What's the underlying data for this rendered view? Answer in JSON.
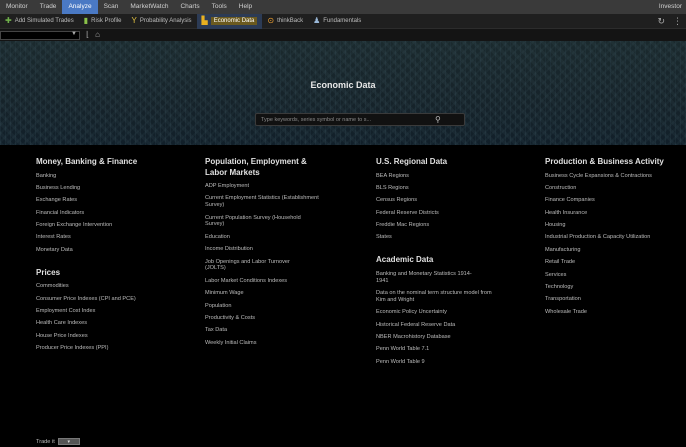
{
  "menubar": {
    "items": [
      "Monitor",
      "Trade",
      "Analyze",
      "Scan",
      "MarketWatch",
      "Charts",
      "Tools",
      "Help"
    ],
    "active_index": 2,
    "right_label": "Investor"
  },
  "toolbar": {
    "items": [
      {
        "icon": "plus-icon",
        "label": "Add Simulated Trades"
      },
      {
        "icon": "risk-profile-icon",
        "label": "Risk Profile"
      },
      {
        "icon": "probability-icon",
        "label": "Probability Analysis"
      },
      {
        "icon": "economic-data-icon",
        "label": "Economic Data"
      },
      {
        "icon": "earnings-icon",
        "label": "thinkBack"
      },
      {
        "icon": "fundamentals-icon",
        "label": "Fundamentals"
      }
    ],
    "active_index": 3
  },
  "hero": {
    "title": "Economic Data",
    "search_placeholder": "Type keywords, series symbol or name to s..."
  },
  "columns": [
    {
      "sections": [
        {
          "title": "Money, Banking & Finance",
          "items": [
            "Banking",
            "Business Lending",
            "Exchange Rates",
            "Financial Indicators",
            "Foreign Exchange Intervention",
            "Interest Rates",
            "Monetary Data"
          ]
        },
        {
          "title": "Prices",
          "items": [
            "Commodities",
            "Consumer Price Indexes (CPI and PCE)",
            "Employment Cost Index",
            "Health Care Indexes",
            "House Price Indexes",
            "Producer Price Indexes (PPI)"
          ]
        }
      ]
    },
    {
      "sections": [
        {
          "title": "Population, Employment & Labor Markets",
          "items": [
            "ADP Employment",
            "Current Employment Statistics (Establishment Survey)",
            "Current Population Survey (Household Survey)",
            "Education",
            "Income Distribution",
            "Job Openings and Labor Turnover (JOLTS)",
            "Labor Market Conditions Indexes",
            "Minimum Wage",
            "Population",
            "Productivity & Costs",
            "Tax Data",
            "Weekly Initial Claims"
          ]
        }
      ]
    },
    {
      "sections": [
        {
          "title": "U.S. Regional Data",
          "items": [
            "BEA Regions",
            "BLS Regions",
            "Census Regions",
            "Federal Reserve Districts",
            "Freddie Mac Regions",
            "States"
          ]
        },
        {
          "title": "Academic Data",
          "items": [
            "Banking and Monetary Statistics 1914-1941",
            "Data on the nominal term structure model from Kim and Wright",
            "Economic Policy Uncertainty",
            "Historical Federal Reserve Data",
            "NBER Macrohistory Database",
            "Penn World Table 7.1",
            "Penn World Table 9"
          ]
        }
      ]
    },
    {
      "sections": [
        {
          "title": "Production & Business Activity",
          "items": [
            "Business Cycle Expansions & Contractions",
            "Construction",
            "Finance Companies",
            "Health Insurance",
            "Housing",
            "Industrial Production & Capacity Utilization",
            "Manufacturing",
            "Retail Trade",
            "Services",
            "Technology",
            "Transportation",
            "Wholesale Trade"
          ]
        }
      ]
    }
  ],
  "trade_bar": {
    "label": "Trade it",
    "button": "▾"
  },
  "colors": {
    "menu_active": "#4a79c4",
    "toolbar_highlight": "#6b5a1f",
    "background": "#000000"
  }
}
